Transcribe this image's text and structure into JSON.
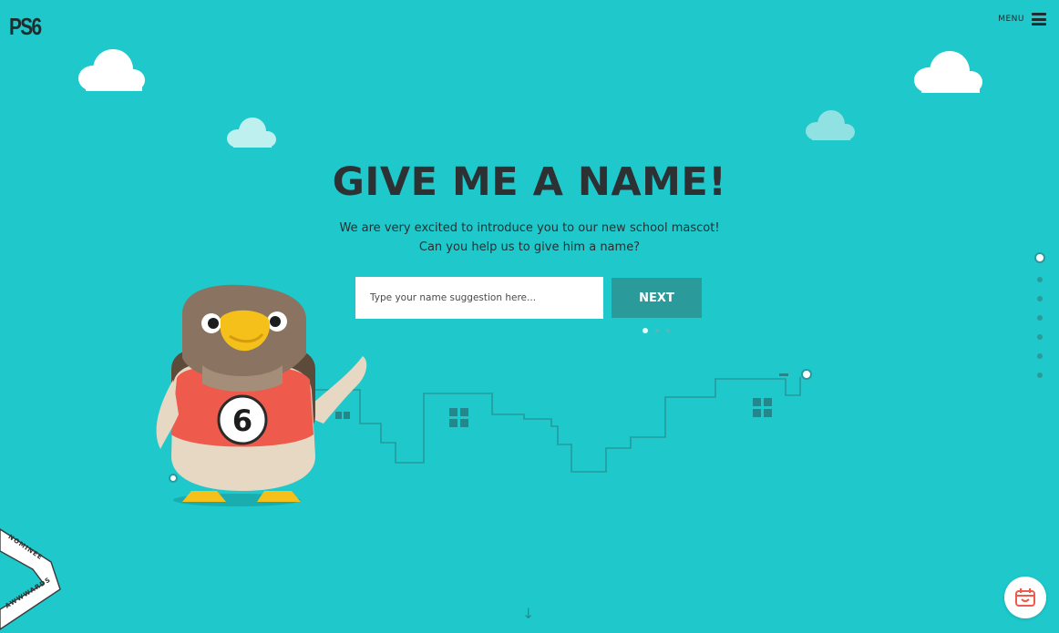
{
  "header": {
    "logo": "PS6",
    "menu_label": "MENU"
  },
  "hero": {
    "title": "GIVE ME A NAME!",
    "subtitle_line1": "We are very excited to introduce you to our new school mascot!",
    "subtitle_line2": "Can you help us to give him a name?"
  },
  "form": {
    "placeholder": "Type your name suggestion here...",
    "value": "",
    "next_label": "NEXT",
    "step_count": 3,
    "active_step": 1
  },
  "mascot": {
    "shirt_number": "6"
  },
  "side_nav": {
    "count": 7,
    "active": 1
  },
  "award": {
    "label_top": "NOMINEE",
    "label_bottom": "AWWWARDS"
  },
  "colors": {
    "background": "#1ec8cb",
    "button": "#2a9a9b",
    "title": "#2e3134",
    "shirt": "#ee5a4b"
  },
  "icons": {
    "menu": "hamburger-icon",
    "scroll": "arrow-down-icon",
    "chat": "calendar-icon"
  }
}
